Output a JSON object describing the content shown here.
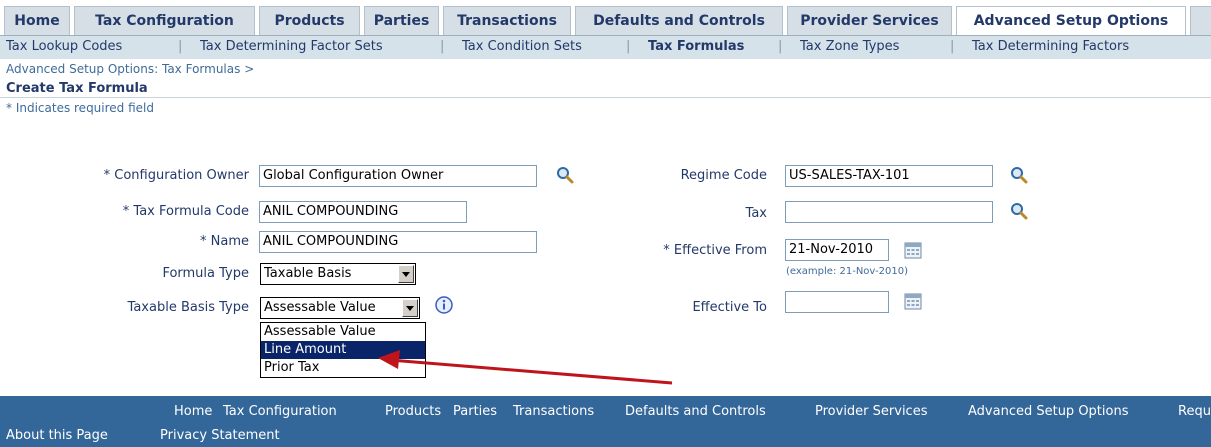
{
  "tabs": [
    {
      "label": "Home"
    },
    {
      "label": "Tax Configuration"
    },
    {
      "label": "Products"
    },
    {
      "label": "Parties"
    },
    {
      "label": "Transactions"
    },
    {
      "label": "Defaults and Controls"
    },
    {
      "label": "Provider Services"
    },
    {
      "label": "Advanced Setup Options"
    }
  ],
  "subnav": [
    {
      "label": "Tax Lookup Codes"
    },
    {
      "label": "Tax Determining Factor Sets"
    },
    {
      "label": "Tax Condition Sets"
    },
    {
      "label": "Tax Formulas"
    },
    {
      "label": "Tax Zone Types"
    },
    {
      "label": "Tax Determining Factors"
    }
  ],
  "breadcrumb": "Advanced Setup Options: Tax Formulas  >",
  "page_title": "Create Tax Formula",
  "required_note": "* Indicates required field",
  "form": {
    "config_owner_label": "* Configuration Owner",
    "config_owner_value": "Global Configuration Owner",
    "formula_code_label": "* Tax Formula Code",
    "formula_code_value": "ANIL COMPOUNDING",
    "name_label": "* Name",
    "name_value": "ANIL COMPOUNDING",
    "formula_type_label": "Formula Type",
    "formula_type_value": "Taxable Basis",
    "basis_type_label": "Taxable Basis Type",
    "basis_type_value": "Assessable Value",
    "regime_label": "Regime Code",
    "regime_value": "US-SALES-TAX-101",
    "tax_label": "Tax",
    "tax_value": "",
    "eff_from_label": "* Effective From",
    "eff_from_value": "21-Nov-2010",
    "eff_example": "(example: 21-Nov-2010)",
    "eff_to_label": "Effective To",
    "eff_to_value": ""
  },
  "dropdown_options": [
    "Assessable Value",
    "Line Amount",
    "Prior Tax"
  ],
  "footer": {
    "links": [
      "Home",
      "Tax Configuration",
      "Products",
      "Parties",
      "Transactions",
      "Defaults and Controls",
      "Provider Services",
      "Advanced Setup Options",
      "Requ"
    ],
    "about": "About this Page",
    "privacy": "Privacy Statement"
  },
  "colors": {
    "brand": "#336699",
    "tab_bg": "#d6dfe5",
    "highlight": "#0a246a",
    "arrow": "#c0141c"
  }
}
